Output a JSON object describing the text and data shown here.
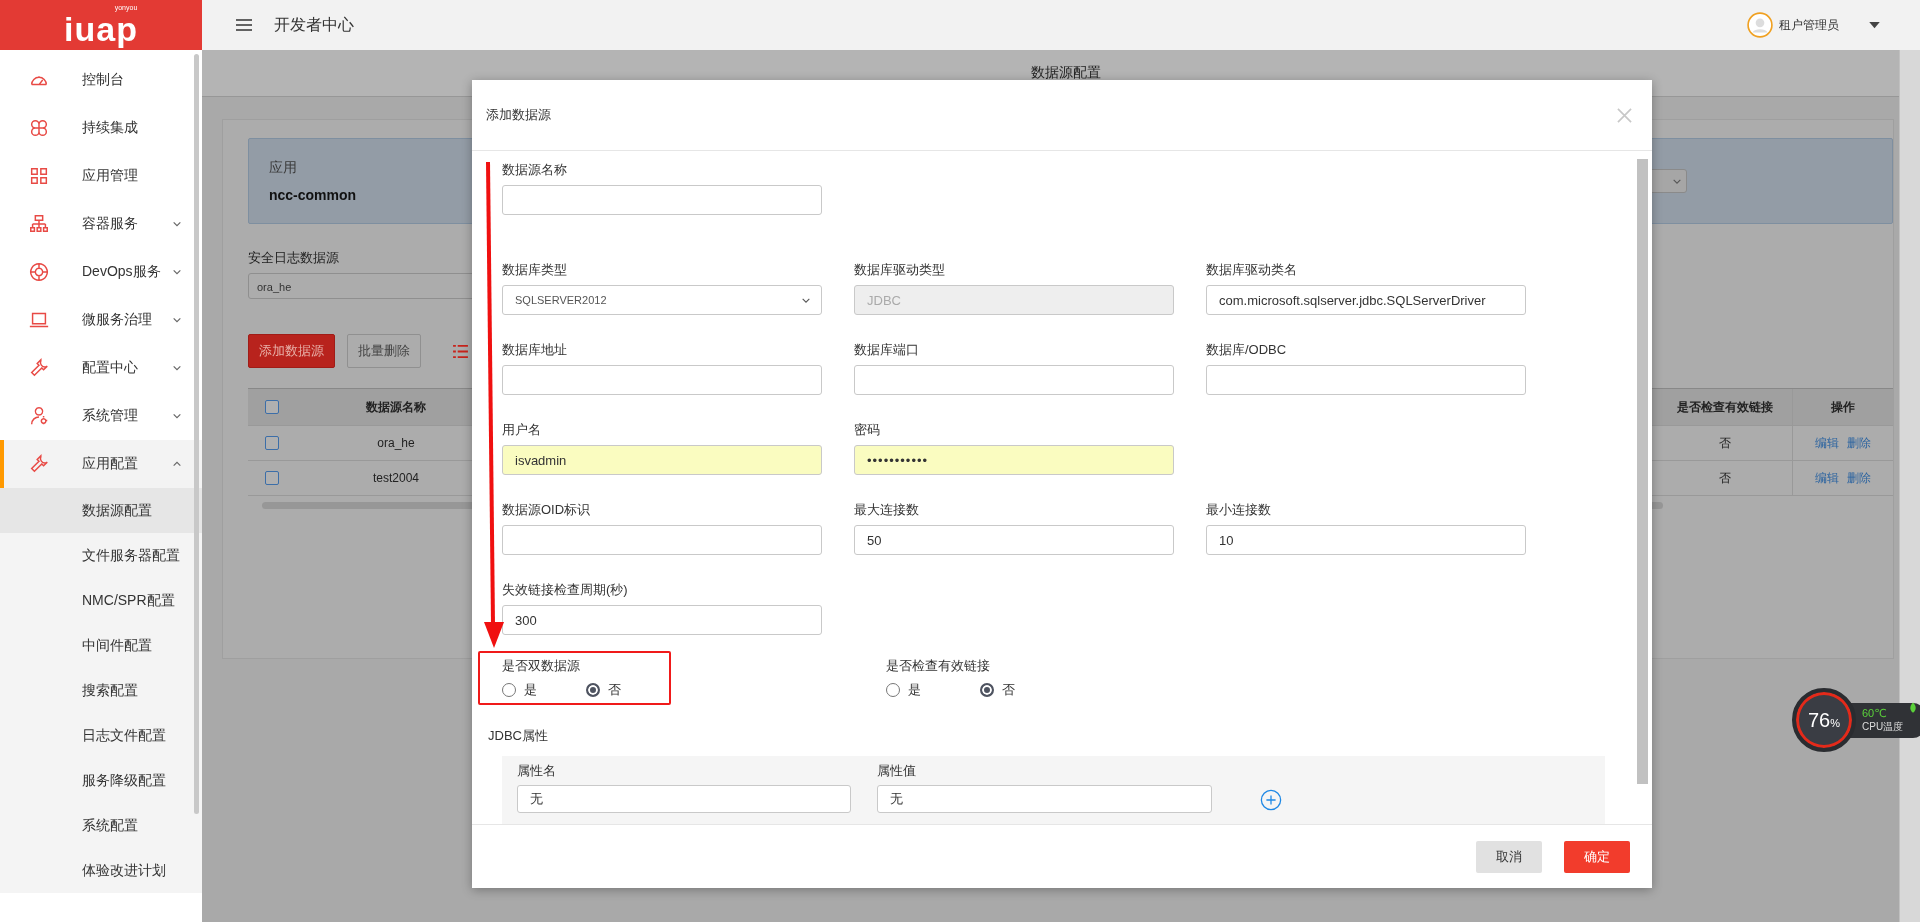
{
  "brand": {
    "logo": "iuap",
    "sub": "yonyou"
  },
  "header": {
    "title": "开发者中心",
    "user": "租户管理员"
  },
  "sidebar": {
    "items": [
      {
        "label": "控制台",
        "kind": "link",
        "selected": false
      },
      {
        "label": "持续集成",
        "kind": "link",
        "selected": false
      },
      {
        "label": "应用管理",
        "kind": "link",
        "selected": false
      },
      {
        "label": "容器服务",
        "kind": "group",
        "selected": false,
        "expanded": false
      },
      {
        "label": "DevOps服务",
        "kind": "group",
        "selected": false,
        "expanded": false
      },
      {
        "label": "微服务治理",
        "kind": "group",
        "selected": false,
        "expanded": false
      },
      {
        "label": "配置中心",
        "kind": "group",
        "selected": false,
        "expanded": false
      },
      {
        "label": "系统管理",
        "kind": "group",
        "selected": false,
        "expanded": false
      },
      {
        "label": "应用配置",
        "kind": "group",
        "selected": true,
        "expanded": true,
        "children": [
          {
            "label": "数据源配置",
            "selected": true
          },
          {
            "label": "文件服务器配置",
            "selected": false
          },
          {
            "label": "NMC/SPR配置",
            "selected": false
          },
          {
            "label": "中间件配置",
            "selected": false
          },
          {
            "label": "搜索配置",
            "selected": false
          },
          {
            "label": "日志文件配置",
            "selected": false
          },
          {
            "label": "服务降级配置",
            "selected": false
          },
          {
            "label": "系统配置",
            "selected": false
          },
          {
            "label": "体验改进计划",
            "selected": false
          }
        ]
      }
    ]
  },
  "page": {
    "title": "数据源配置",
    "app_info": {
      "label": "应用",
      "value": "ncc-common"
    },
    "security_log": {
      "label": "安全日志数据源",
      "value": "ora_he"
    },
    "toolbar": [
      {
        "label": "添加数据源",
        "kind": "primary"
      },
      {
        "label": "批量删除",
        "kind": "default"
      }
    ],
    "table": {
      "select_all_checked": false,
      "columns": [
        "数据源名称",
        "是否检查有效链接",
        "操作"
      ],
      "rows": [
        {
          "checked": false,
          "name": "ora_he",
          "check_link": "否",
          "actions": [
            "编辑",
            "删除"
          ]
        },
        {
          "checked": false,
          "name": "test2004",
          "check_link": "否",
          "actions": [
            "编辑",
            "删除"
          ]
        }
      ]
    }
  },
  "modal": {
    "title": "添加数据源",
    "name_field": {
      "label": "数据源名称"
    },
    "rows": [
      [
        {
          "label": "数据库类型",
          "kind": "select",
          "value": "SQLSERVER2012",
          "disabled": false,
          "autofilled": false
        },
        {
          "label": "数据库驱动类型",
          "kind": "text",
          "value": "JDBC",
          "disabled": true,
          "autofilled": false
        },
        {
          "label": "数据库驱动类名",
          "kind": "text",
          "value": "com.microsoft.sqlserver.jdbc.SQLServerDriver",
          "disabled": false,
          "autofilled": false
        }
      ],
      [
        {
          "label": "数据库地址",
          "kind": "text",
          "disabled": false,
          "autofilled": false
        },
        {
          "label": "数据库端口",
          "kind": "text",
          "disabled": false,
          "autofilled": false
        },
        {
          "label": "数据库/ODBC",
          "kind": "text",
          "disabled": false,
          "autofilled": false
        }
      ],
      [
        {
          "label": "用户名",
          "kind": "text",
          "value": "isvadmin",
          "disabled": false,
          "autofilled": true
        },
        {
          "label": "密码",
          "kind": "password",
          "value": "•••••••••••",
          "disabled": false,
          "autofilled": true
        }
      ],
      [
        {
          "label": "数据源OID标识",
          "kind": "text",
          "disabled": false,
          "autofilled": false
        },
        {
          "label": "最大连接数",
          "kind": "text",
          "value": "50",
          "disabled": false,
          "autofilled": false
        },
        {
          "label": "最小连接数",
          "kind": "text",
          "value": "10",
          "disabled": false,
          "autofilled": false
        }
      ],
      [
        {
          "label": "失效链接检查周期(秒)",
          "kind": "text",
          "value": "300",
          "disabled": false,
          "autofilled": false
        }
      ]
    ],
    "radio_groups": [
      {
        "label": "是否双数据源",
        "highlighted": true,
        "options": [
          {
            "label": "是",
            "selected": false
          },
          {
            "label": "否",
            "selected": true
          }
        ]
      },
      {
        "label": "是否检查有效链接",
        "highlighted": false,
        "options": [
          {
            "label": "是",
            "selected": false
          },
          {
            "label": "否",
            "selected": true
          }
        ]
      }
    ],
    "jdbc": {
      "title": "JDBC属性",
      "columns": [
        "属性名",
        "属性值"
      ],
      "values": [
        "无",
        "无"
      ]
    },
    "buttons": [
      {
        "label": "取消",
        "kind": "default"
      },
      {
        "label": "确定",
        "kind": "primary"
      }
    ]
  },
  "cpu_widget": {
    "percent": "76",
    "unit": "%",
    "temperature": "60℃",
    "label": "CPU温度"
  }
}
